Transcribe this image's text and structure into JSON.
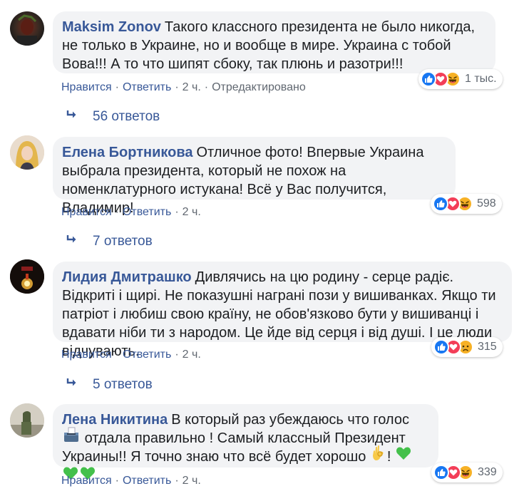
{
  "comments": [
    {
      "author": "Maksim Zonov",
      "text": "Такого классного президента не было никогда, не только в Украине, но и вообще в мире. Украина с тобой Вова!!! А то что шипят сбоку, так плюнь и разотри!!!",
      "like": "Нравится",
      "reply": "Ответить",
      "time": "2 ч.",
      "edited": "Отредактировано",
      "reaction_count": "1 тыс.",
      "replies": "56 ответов"
    },
    {
      "author": "Елена Бортникова",
      "text": "Отличное фото! Впервые Украина выбрала президента, который не похож на номенклатурного истукана! Всё у Вас получится, Владимир!",
      "like": "Нравится",
      "reply": "Ответить",
      "time": "2 ч.",
      "reaction_count": "598",
      "replies": "7 ответов"
    },
    {
      "author": "Лидия Дмитрашко",
      "text": "Дивлячись на цю родину - серце радіє. Відкриті і щирі. Не показушні награні пози у вишиванках. Якщо ти патріот і любиш свою країну, не обов'язково бути у вишиванці і вдавати ніби ти з народом. Це йде від серця і від душі. І це люди відчувають.",
      "like": "Нравится",
      "reply": "Ответить",
      "time": "2 ч.",
      "reaction_count": "315",
      "replies": "5 ответов"
    },
    {
      "author": "Лена Никитина",
      "text_part1": "В который раз убеждаюсь что голос",
      "text_part2": "отдала правильно ! Самый классный Президент Украины!! Я точно знаю что всё будет хорошо",
      "text_part3": "!",
      "like": "Нравится",
      "reply": "Ответить",
      "time": "2 ч.",
      "reaction_count": "339"
    }
  ],
  "icons": {
    "like": "like-reaction-icon",
    "love": "love-reaction-icon",
    "haha": "haha-reaction-icon",
    "sad": "sad-reaction-icon",
    "reply_arrow": "reply-arrow-icon",
    "ballot": "ballot-box-icon",
    "ok_hand": "ok-hand-icon",
    "green_heart": "green-heart-icon"
  },
  "colors": {
    "link": "#385898",
    "bubble": "#f2f3f5",
    "meta": "#606770",
    "like": "#1877f2",
    "love": "#f33e58",
    "haha": "#f7b125",
    "green_heart": "#44c04b"
  }
}
